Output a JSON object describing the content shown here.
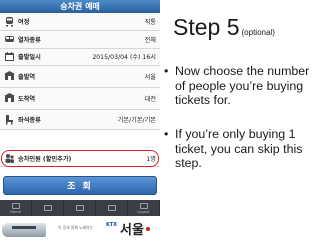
{
  "phone": {
    "title": "승차권 예매",
    "rows": [
      {
        "label": "여정",
        "value": "직통",
        "icon": "train-icon"
      },
      {
        "label": "열차종류",
        "value": "전체",
        "icon": "train-type-icon"
      },
      {
        "label": "출발일시",
        "value": "2015/03/04 (수) 16시",
        "icon": "calendar-icon"
      },
      {
        "label": "출발역",
        "value": "서울",
        "icon": "departure-station-icon"
      },
      {
        "label": "도착역",
        "value": "대전",
        "icon": "arrival-station-icon"
      },
      {
        "label": "좌석종류",
        "value": "기본/기본/기본",
        "icon": "seat-icon"
      },
      {
        "label": "승차인원 (할인추가)",
        "value": "1명",
        "icon": "passengers-icon"
      }
    ],
    "query_button": "조  회",
    "tabs": [
      "Home",
      "",
      "",
      "",
      "Logout"
    ],
    "banner": {
      "subtitle": "이 땅과 함께 노래하는",
      "brand": "KTX",
      "city": "서울",
      "colors": {
        "accent": "#d4241c",
        "blue": "#2d66ad"
      }
    }
  },
  "slide": {
    "title": "Step 5",
    "title_note": "(optional)",
    "bullets": [
      "Now choose the number of people you’re buying tickets for.",
      "If you’re only buying 1 ticket, you can skip this step."
    ]
  }
}
